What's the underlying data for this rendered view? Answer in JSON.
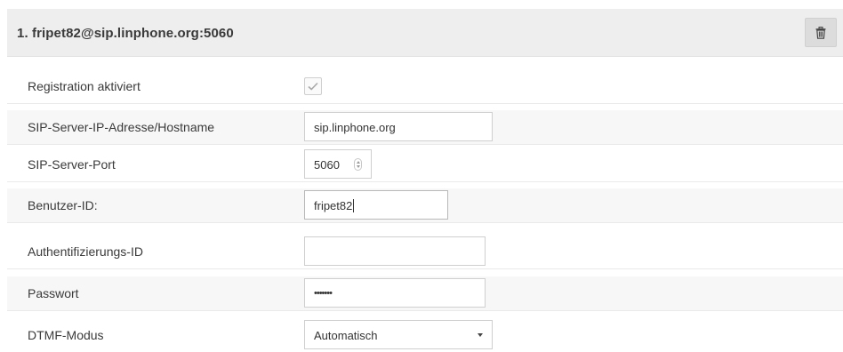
{
  "account": {
    "title": "1. fripet82@sip.linphone.org:5060",
    "delete_icon": "trash-icon"
  },
  "fields": {
    "registration": {
      "label": "Registration aktiviert",
      "checked": true
    },
    "server_host": {
      "label": "SIP-Server-IP-Adresse/Hostname",
      "value": "sip.linphone.org"
    },
    "server_port": {
      "label": "SIP-Server-Port",
      "value": "5060"
    },
    "user_id": {
      "label": "Benutzer-ID:",
      "value": "fripet82"
    },
    "auth_id": {
      "label": "Authentifizierungs-ID",
      "value": ""
    },
    "password": {
      "label": "Passwort",
      "value": "•••••••"
    },
    "dtmf": {
      "label": "DTMF-Modus",
      "value": "Automatisch"
    }
  }
}
